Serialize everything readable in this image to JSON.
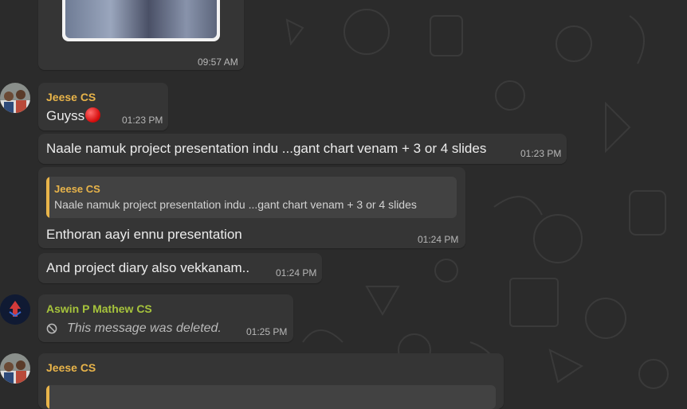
{
  "theme": {
    "background": "#2b2b2b",
    "bubble": "#353535",
    "jeese_name_color": "#e8b44a",
    "aswin_name_color": "#a6c33c",
    "quote_bar": "#e8b44a"
  },
  "messages": [
    {
      "type": "image",
      "time": "09:57 AM"
    },
    {
      "type": "text",
      "sender": "Jeese CS",
      "text": "Guyss",
      "emoji": "red-circle",
      "time": "01:23 PM"
    },
    {
      "type": "text",
      "text": "Naale namuk project presentation indu ...gant chart venam + 3 or 4 slides",
      "time": "01:23 PM"
    },
    {
      "type": "reply",
      "quote_sender": "Jeese CS",
      "quote_text": "Naale namuk project presentation indu ...gant chart venam + 3 or 4 slides",
      "text": "Enthoran aayi ennu presentation",
      "time": "01:24 PM"
    },
    {
      "type": "text",
      "text": "And project diary also vekkanam..",
      "time": "01:24 PM"
    },
    {
      "type": "deleted",
      "sender": "Aswin P Mathew CS",
      "text": "This message was deleted.",
      "time": "01:25 PM"
    },
    {
      "type": "reply-partial",
      "sender": "Jeese CS"
    }
  ]
}
